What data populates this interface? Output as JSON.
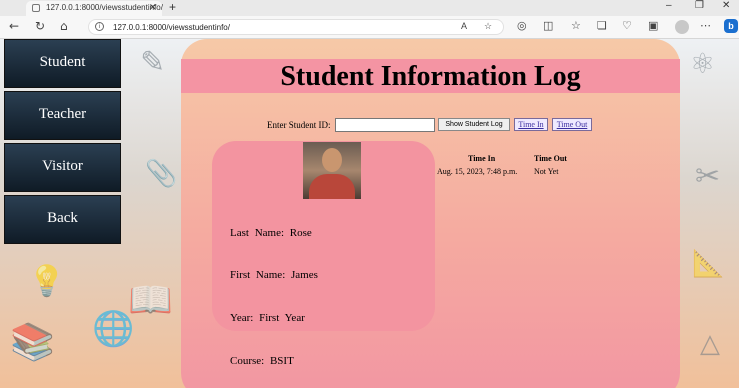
{
  "browser": {
    "tab_title": "127.0.0.1:8000/viewsstudentinfo/",
    "url": "127.0.0.1:8000/viewsstudentinfo/",
    "new_tab": "+",
    "window_minimize": "–",
    "window_restore": "❐",
    "window_close": "✕",
    "bing_label": "b"
  },
  "sidebar": {
    "items": [
      {
        "label": "Student"
      },
      {
        "label": "Teacher"
      },
      {
        "label": "Visitor"
      },
      {
        "label": "Back"
      }
    ]
  },
  "page": {
    "title": "Student Information Log",
    "search": {
      "label": "Enter Student ID:",
      "value": "",
      "button_show": "Show Student Log",
      "button_time_in": "Time In",
      "button_time_out": "Time Out"
    },
    "profile": {
      "last_name": "Last   Name:   Rose",
      "first_name": "First   Name:   James",
      "year": "Year:   First   Year",
      "course": "Course:   BSIT"
    },
    "log": {
      "headers": [
        "Time In",
        "Time Out"
      ],
      "rows": [
        [
          "Aug. 15, 2023, 7:48 p.m.",
          "Not Yet"
        ]
      ]
    }
  },
  "colors": {
    "header_band": "#f494a3",
    "profile_card": "#f394a0",
    "nav_button": "#1a2836"
  }
}
